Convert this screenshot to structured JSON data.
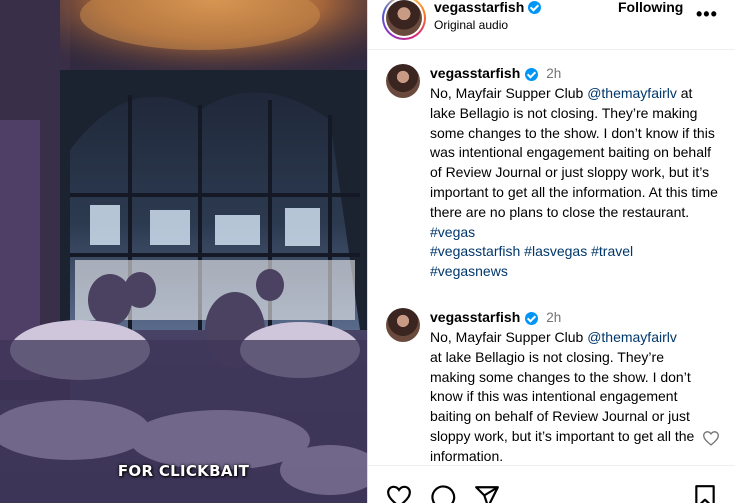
{
  "video": {
    "caption": "FOR CLICKBAIT"
  },
  "header": {
    "username": "vegasstarfish",
    "audio": "Original audio",
    "following_label": "Following",
    "more_label": "•••"
  },
  "comments": [
    {
      "username": "vegasstarfish",
      "time": "2h",
      "text_1": "No, Mayfair Supper Club ",
      "mention": "@themayfairlv",
      "text_2": " at lake Bellagio is not closing. They’re making some changes to the show. I don’t know if this was intentional engagement baiting on behalf of Review Journal or just sloppy work, but it’s important to get all the information. At this time there are no plans to close the restaurant. ",
      "tags": [
        "#vegas",
        "#vegasstarfish",
        "#lasvegas",
        "#travel",
        "#vegasnews"
      ]
    },
    {
      "username": "vegasstarfish",
      "time": "2h",
      "text_1": "No, Mayfair Supper Club ",
      "mention": "@themayfairlv",
      "text_2": "at lake Bellagio is not closing. They’re making some changes to the show. I don’t know if this was intentional engagement baiting on behalf of Review Journal or just sloppy work, but it’s important to get all the information."
    }
  ],
  "icons": {
    "verified": "verified-badge-icon",
    "like": "heart-icon",
    "comment": "comment-icon",
    "share": "share-icon",
    "save": "bookmark-icon"
  },
  "colors": {
    "verified": "#0095f6",
    "link": "#00376b",
    "muted": "#737373"
  }
}
